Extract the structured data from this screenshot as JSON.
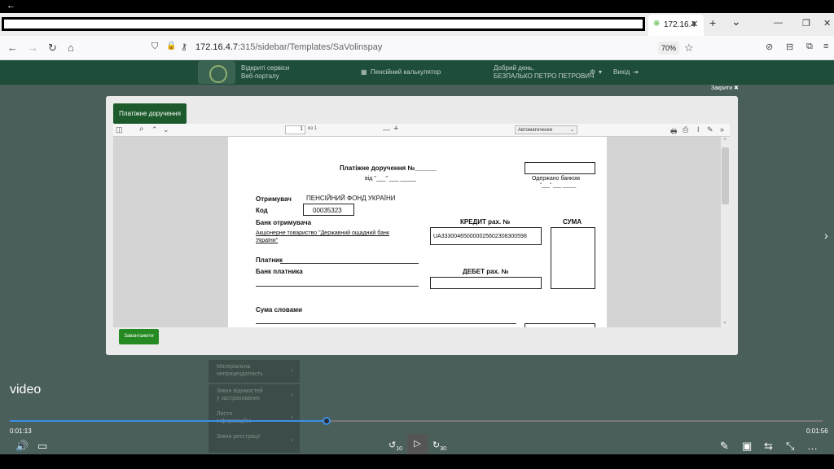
{
  "player": {
    "back_icon": "←",
    "label": "video",
    "time_current": "0:01:13",
    "time_total": "0:01:56",
    "progress_fraction": 0.39,
    "controls": {
      "volume_icon": "🔊",
      "captions_icon": "▭",
      "rewind_label": "10",
      "play_icon": "▷",
      "forward_label": "30",
      "edit_icon": "✎",
      "display_icon": "▣",
      "cast_icon": "⇆",
      "shrink_icon": "⤡",
      "more_icon": "…"
    },
    "next_icon": "›"
  },
  "browser": {
    "tab_title": "172.16.4",
    "tab_favicon": "❋",
    "tab_close": "✕",
    "new_tab": "+",
    "tab_list": "⌄",
    "minimize": "—",
    "restore": "❐",
    "close": "✕",
    "url_host": "172.16.4.7",
    "url_rest": ":315/sidebar/Templates/SaVolinspay",
    "zoom": "70%",
    "nav": {
      "back": "←",
      "forward": "→",
      "reload": "↻",
      "home": "⌂",
      "shield": "⛉",
      "lock": "🔒",
      "key": "⚷",
      "star": "☆",
      "pocket": "⊘",
      "reader": "⊟",
      "extensions": "⧉",
      "menu": "≡"
    }
  },
  "site": {
    "title_line1": "Відкриті сервіси",
    "title_line2": "Веб-порталу",
    "calculator": "Пенсійний калькулятор",
    "calculator_icon": "▦",
    "greeting_line1": "Добрий день,",
    "greeting_line2": "БЕЗПАЛЬКО ПЕТРО ПЕТРОВИЧ",
    "settings_icon": "⚙",
    "settings_caret": "▾",
    "logout": "Вихід",
    "logout_icon": "⇥",
    "close_modal": "Закрити ✖"
  },
  "sidebar": {
    "items": [
      {
        "label": "Матеріальна\nнепрацездатність"
      },
      {
        "label": "Зміни відомостей\nу застрахованих"
      },
      {
        "label": "Листи\nінформаційні"
      },
      {
        "label": "Зміни реєстрації"
      }
    ],
    "chevron": "›"
  },
  "modal": {
    "tab_label": "Платіжне доручення",
    "download_label": "Завантажити",
    "pdf_toolbar": {
      "sidebar_icon": "◫",
      "search_icon": "⌕",
      "up_icon": "⌃",
      "down_icon": "⌄",
      "page_number": "1",
      "page_of": "из 1",
      "zoom_out": "—",
      "zoom_in": "+",
      "zoom_value": "Автоматически",
      "zoom_caret": "⌄",
      "print_icon": "🖶",
      "save_icon": "⎙",
      "text_icon": "I",
      "draw_icon": "✎",
      "more_icon": "»"
    }
  },
  "document": {
    "title": "Платіжне доручення №______",
    "date_line": "від \"___\" ___ _____",
    "bank_received": "Одержано банком",
    "bank_date": "\"___\" ___ _____",
    "recipient_label": "Отримувач",
    "recipient_value": "ПЕНСІЙНИЙ ФОНД УКРАЇНИ",
    "code_label": "Код",
    "code_value": "00035323",
    "recipient_bank_label": "Банк отримувача",
    "recipient_bank_value_line1": "Акціонерне товариство \"Державний ощадний банк",
    "recipient_bank_value_line2": "України\"",
    "credit_label": "КРЕДИТ рах. №",
    "credit_value": "UA333004650000025602308300598",
    "sum_label": "СУМА",
    "payer_label": "Платник",
    "payer_bank_label": "Банк платника",
    "debit_label": "ДЕБЕТ рах. №",
    "words_label": "Сума словами"
  }
}
